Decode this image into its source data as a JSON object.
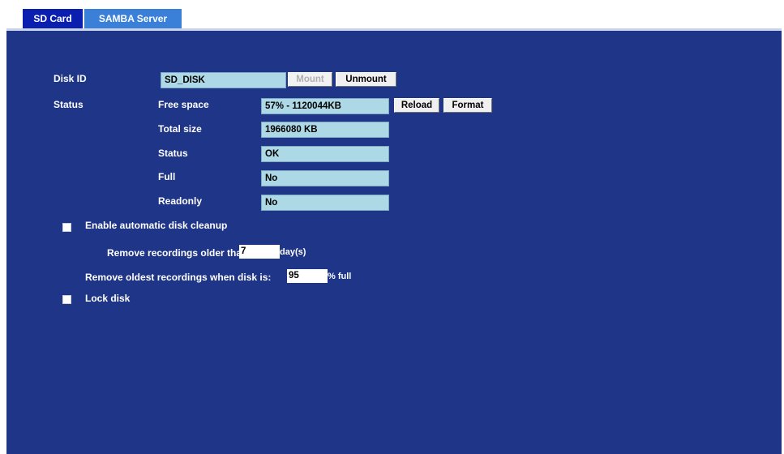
{
  "tabs": [
    {
      "label": "SD Card",
      "active": true
    },
    {
      "label": "SAMBA Server",
      "active": false
    }
  ],
  "disk": {
    "id_label": "Disk ID",
    "id_value": "SD_DISK",
    "mount_label": "Mount",
    "unmount_label": "Unmount"
  },
  "status": {
    "section_label": "Status",
    "free_space_label": "Free space",
    "free_space_value": "57% - 1120044KB",
    "reload_label": "Reload",
    "format_label": "Format",
    "total_size_label": "Total size",
    "total_size_value": "1966080 KB",
    "status_label": "Status",
    "status_value": "OK",
    "full_label": "Full",
    "full_value": "No",
    "readonly_label": "Readonly",
    "readonly_value": "No"
  },
  "cleanup": {
    "enable_label": "Enable automatic disk cleanup",
    "enabled": false,
    "older_than_label": "Remove recordings older than:",
    "older_than_value": "7",
    "older_than_unit": "day(s)",
    "disk_full_label": "Remove oldest recordings when disk is:",
    "disk_full_value": "95",
    "disk_full_unit": "% full"
  },
  "lock": {
    "label": "Lock disk",
    "checked": false
  },
  "colors": {
    "panel_bg": "#1e3588",
    "field_bg": "#add8e6",
    "tab_active": "#0a1fb0",
    "tab_inactive": "#3a7fd8"
  }
}
